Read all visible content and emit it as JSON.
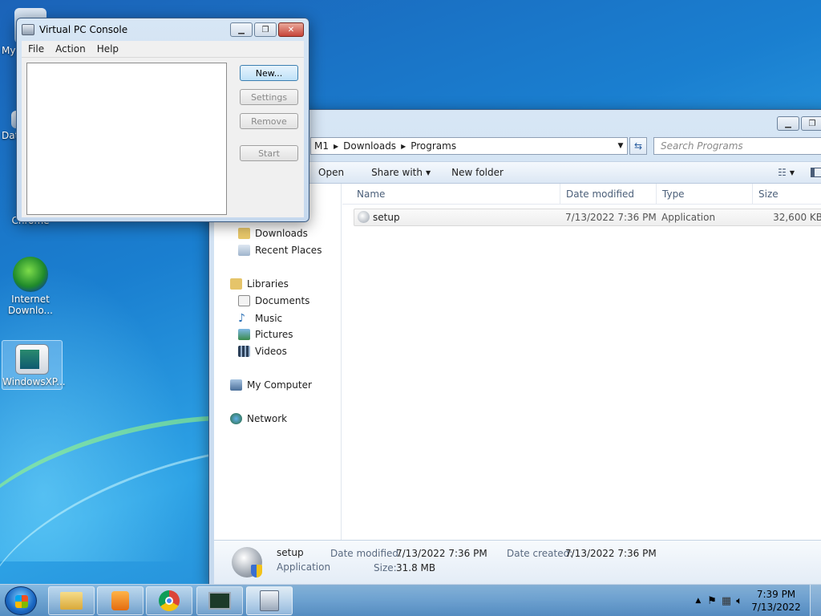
{
  "desktop": {
    "icons": [
      {
        "label": "My",
        "icon": "computer-icon"
      },
      {
        "label": "Dat",
        "icon": "data-icon"
      },
      {
        "label": "Chrome",
        "icon": "chrome-icon"
      },
      {
        "label": "Internet Downlo...",
        "icon": "idm-icon"
      },
      {
        "label": "WindowsXP...",
        "icon": "vhd-icon"
      }
    ]
  },
  "vpc_console": {
    "title": "Virtual PC Console",
    "menu": [
      "File",
      "Action",
      "Help"
    ],
    "buttons": {
      "new": "New...",
      "settings": "Settings",
      "remove": "Remove",
      "start": "Start"
    }
  },
  "explorer": {
    "breadcrumb": [
      "M1",
      "Downloads",
      "Programs"
    ],
    "search_placeholder": "Search Programs",
    "commands": {
      "open": "Open",
      "share_with": "Share with",
      "new_folder": "New folder"
    },
    "nav": {
      "downloads": "Downloads",
      "recent_places": "Recent Places",
      "libraries": "Libraries",
      "documents": "Documents",
      "music": "Music",
      "pictures": "Pictures",
      "videos": "Videos",
      "my_computer": "My Computer",
      "network": "Network"
    },
    "columns": {
      "name": "Name",
      "date_modified": "Date modified",
      "type": "Type",
      "size": "Size"
    },
    "files": [
      {
        "name": "setup",
        "date_modified": "7/13/2022 7:36 PM",
        "type": "Application",
        "size": "32,600 KB"
      }
    ],
    "details": {
      "name": "setup",
      "type": "Application",
      "date_modified_label": "Date modified:",
      "date_modified": "7/13/2022 7:36 PM",
      "date_created_label": "Date created:",
      "date_created": "7/13/2022 7:36 PM",
      "size_label": "Size:",
      "size": "31.8 MB"
    }
  },
  "taskbar": {
    "time": "7:39 PM",
    "date": "7/13/2022"
  }
}
